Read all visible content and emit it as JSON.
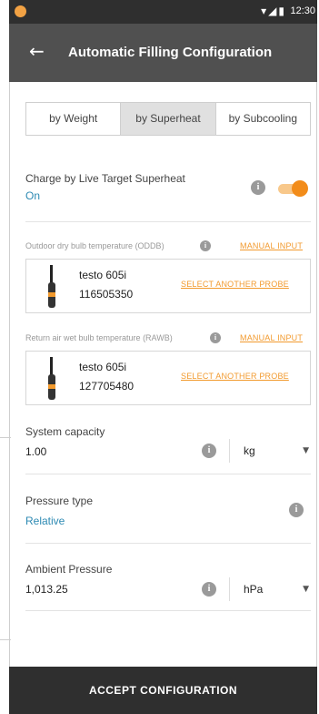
{
  "status_bar": {
    "time": "12:30",
    "icons": [
      "app-dot-icon",
      "wifi-icon",
      "signal-icon",
      "battery-icon"
    ]
  },
  "app_bar": {
    "title": "Automatic Filling Configuration",
    "back_icon": "arrow-left-icon"
  },
  "tabs": [
    {
      "label": "by Weight",
      "active": false
    },
    {
      "label": "by Superheat",
      "active": true
    },
    {
      "label": "by Subcooling",
      "active": false
    }
  ],
  "live_target": {
    "label": "Charge by Live Target Superheat",
    "value": "On",
    "toggle_on": true
  },
  "oddb": {
    "label": "Outdoor dry bulb temperature (ODDB)",
    "manual_link": "MANUAL INPUT",
    "probe": {
      "name": "testo 605i",
      "serial": "116505350",
      "select_label": "SELECT ANOTHER PROBE"
    }
  },
  "rawb": {
    "label": "Return air wet bulb temperature (RAWB)",
    "manual_link": "MANUAL INPUT",
    "probe": {
      "name": "testo 605i",
      "serial": "127705480",
      "select_label": "SELECT ANOTHER PROBE"
    }
  },
  "system_capacity": {
    "label": "System capacity",
    "value": "1.00",
    "unit": "kg"
  },
  "pressure_type": {
    "label": "Pressure type",
    "value": "Relative"
  },
  "ambient_pressure": {
    "label": "Ambient Pressure",
    "value": "1,013.25",
    "unit": "hPa"
  },
  "footer": {
    "accept_label": "ACCEPT CONFIGURATION"
  },
  "colors": {
    "accent": "#f28c1a",
    "link_blue": "#2d8ab3",
    "app_bar": "#505050",
    "status_bar": "#2f2f2f"
  }
}
